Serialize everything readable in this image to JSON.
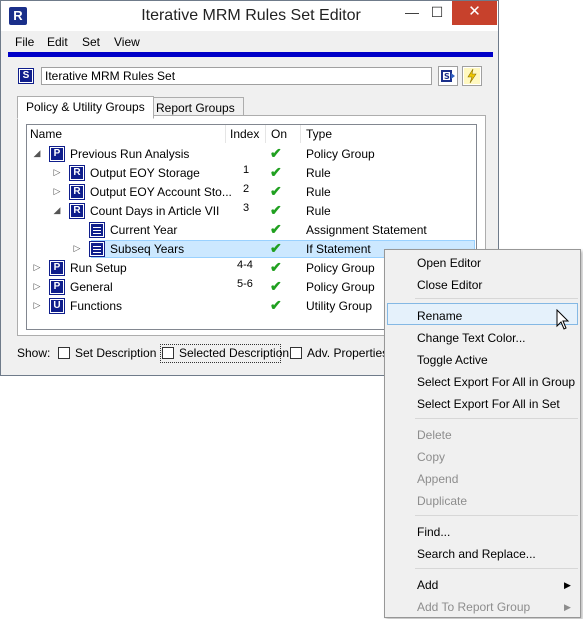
{
  "window": {
    "title": "Iterative MRM Rules Set Editor",
    "app_icon_letter": "R",
    "min_glyph": "—",
    "max_glyph": "☐",
    "close_glyph": "✕"
  },
  "menu": {
    "file": "File",
    "edit": "Edit",
    "set": "Set",
    "view": "View"
  },
  "set_icon_letter": "S",
  "set_name": "Iterative MRM Rules Set",
  "tabs": {
    "policy": "Policy & Utility Groups",
    "report": "Report Groups"
  },
  "columns": {
    "name": "Name",
    "index": "Index",
    "on": "On",
    "type": "Type"
  },
  "rows": [
    {
      "icon": "P",
      "name": "Previous Run Analysis",
      "index": "",
      "type": "Policy Group",
      "expander": "◢"
    },
    {
      "icon": "R",
      "name": "Output EOY Storage",
      "index": "1",
      "type": "Rule",
      "expander": "▷"
    },
    {
      "icon": "R",
      "name": "Output EOY Account Sto...",
      "index": "2",
      "type": "Rule",
      "expander": "▷"
    },
    {
      "icon": "R",
      "name": "Count Days in Article VII",
      "index": "3",
      "type": "Rule",
      "expander": "◢"
    },
    {
      "icon": "S",
      "name": "Current Year",
      "index": "",
      "type": "Assignment Statement",
      "expander": ""
    },
    {
      "icon": "S",
      "name": "Subseq Years",
      "index": "",
      "type": "If Statement",
      "expander": "▷"
    },
    {
      "icon": "P",
      "name": "Run Setup",
      "index": "4-4",
      "type": "Policy Group",
      "expander": "▷"
    },
    {
      "icon": "P",
      "name": "General",
      "index": "5-6",
      "type": "Policy Group",
      "expander": "▷"
    },
    {
      "icon": "U",
      "name": "Functions",
      "index": "",
      "type": "Utility Group",
      "expander": "▷"
    }
  ],
  "check_glyph": "✔",
  "show": {
    "label": "Show:",
    "set_description": "Set Description",
    "selected_description": "Selected Description",
    "adv_properties": "Adv. Properties"
  },
  "context_menu": {
    "open_editor": "Open Editor",
    "close_editor": "Close Editor",
    "rename": "Rename",
    "change_text_color": "Change Text Color...",
    "toggle_active": "Toggle Active",
    "select_export_group": "Select Export For All in Group",
    "select_export_set": "Select Export For All in Set",
    "delete": "Delete",
    "copy": "Copy",
    "append": "Append",
    "duplicate": "Duplicate",
    "find": "Find...",
    "search_replace": "Search and Replace...",
    "add": "Add",
    "add_to_report_group": "Add To Report Group",
    "submenu_arrow": "▶"
  },
  "colors": {
    "accent_blue": "#0000c8",
    "icon_navy": "#0f1e8c",
    "close_red": "#c7412c",
    "selection": "#cce8ff",
    "check_green": "#20a020"
  }
}
